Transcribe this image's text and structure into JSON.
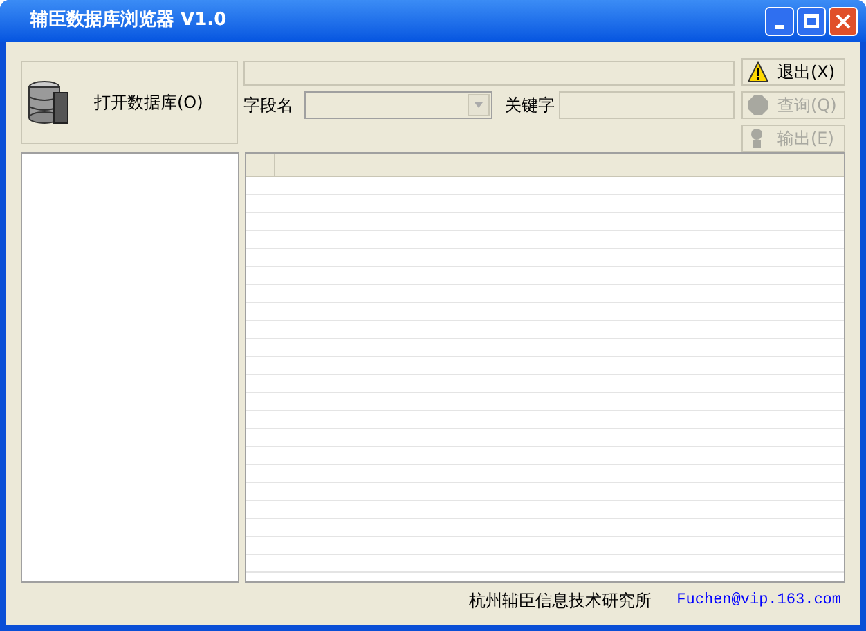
{
  "window": {
    "title": "辅臣数据库浏览器 V1.0"
  },
  "open_button": {
    "label": "打开数据库(O)"
  },
  "filter": {
    "field_label": "字段名",
    "keyword_label": "关键字"
  },
  "buttons": [
    {
      "label": "退出(X)",
      "kind": "warning",
      "disabled": false
    },
    {
      "label": "查询(Q)",
      "kind": "query",
      "disabled": true
    },
    {
      "label": "输出(E)",
      "kind": "export",
      "disabled": true
    }
  ],
  "status_bar": {
    "company": "杭州辅臣信息技术研究所",
    "email": "Fuchen@vip.163.com"
  }
}
